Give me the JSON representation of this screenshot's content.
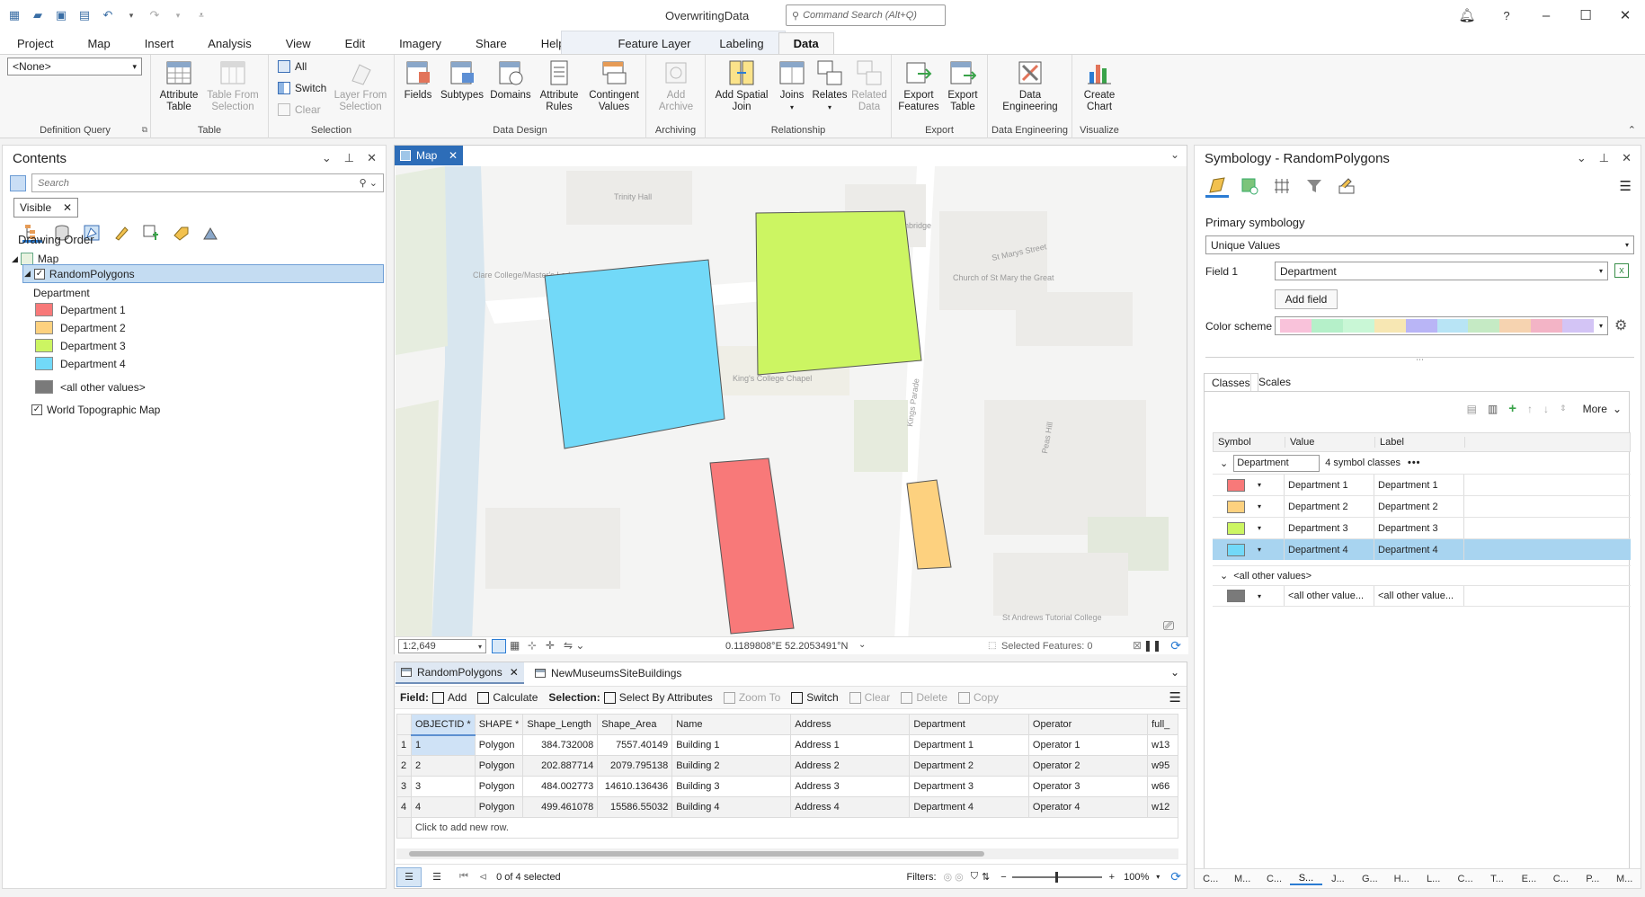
{
  "app": {
    "window_title": "OverwritingData",
    "command_search_placeholder": "Command Search (Alt+Q)"
  },
  "ribbon_tabs": [
    "Project",
    "Map",
    "Insert",
    "Analysis",
    "View",
    "Edit",
    "Imagery",
    "Share",
    "Help",
    "Feature Layer",
    "Labeling",
    "Data"
  ],
  "ribbon": {
    "definition_query_value": "<None>",
    "groups": {
      "definition_query": "Definition Query",
      "table": "Table",
      "selection": "Selection",
      "data_design": "Data Design",
      "archiving": "Archiving",
      "relationship": "Relationship",
      "export": "Export",
      "data_engineering": "Data Engineering",
      "visualize": "Visualize"
    },
    "buttons": {
      "attribute_table": "Attribute Table",
      "table_from_selection": "Table From Selection",
      "all": "All",
      "switch": "Switch",
      "clear": "Clear",
      "layer_from_selection": "Layer From Selection",
      "fields": "Fields",
      "subtypes": "Subtypes",
      "domains": "Domains",
      "attribute_rules": "Attribute Rules",
      "contingent_values": "Contingent Values",
      "add_archive": "Add Archive",
      "add_spatial_join": "Add Spatial Join",
      "joins": "Joins",
      "relates": "Relates",
      "related_data": "Related Data",
      "export_features": "Export Features",
      "export_table": "Export Table",
      "data_engineering": "Data Engineering",
      "create_chart": "Create Chart"
    }
  },
  "contents": {
    "title": "Contents",
    "search_placeholder": "Search",
    "filter_chip": "Visible",
    "drawing_order": "Drawing Order",
    "map_node": "Map",
    "layer": "RandomPolygons",
    "field_heading": "Department",
    "classes": [
      {
        "label": "Department 1",
        "color": "#f87979"
      },
      {
        "label": "Department 2",
        "color": "#fdd17f"
      },
      {
        "label": "Department 3",
        "color": "#ccf562"
      },
      {
        "label": "Department 4",
        "color": "#72d9f8"
      }
    ],
    "other_values": {
      "label": "<all other values>",
      "color": "#7a7a7a"
    },
    "basemap": "World Topographic Map"
  },
  "map": {
    "tab_label": "Map",
    "scale": "1:2,649",
    "coordinates": "0.1189808°E 52.2053491°N",
    "selected_features": "Selected Features: 0",
    "basemap_labels": [
      "Trinity Hall",
      "University of Cambridge",
      "St Marys Street",
      "Clare College/Master's Lodge",
      "Church of St Mary the Great",
      "King's College Chapel",
      "Kings Parade",
      "Peas Hill",
      "St Andrews Tutorial College"
    ]
  },
  "table": {
    "tabs": [
      "RandomPolygons",
      "NewMuseumsSiteBuildings"
    ],
    "toolbar": {
      "field_label": "Field:",
      "add": "Add",
      "calculate": "Calculate",
      "selection_label": "Selection:",
      "select_by_attributes": "Select By Attributes",
      "zoom_to": "Zoom To",
      "switch": "Switch",
      "clear": "Clear",
      "delete": "Delete",
      "copy": "Copy"
    },
    "columns": [
      "OBJECTID *",
      "SHAPE *",
      "Shape_Length",
      "Shape_Area",
      "Name",
      "Address",
      "Department",
      "Operator",
      "full_"
    ],
    "rows": [
      [
        "1",
        "Polygon",
        "384.732008",
        "7557.40149",
        "Building 1",
        "Address 1",
        "Department 1",
        "Operator 1",
        "w13"
      ],
      [
        "2",
        "Polygon",
        "202.887714",
        "2079.795138",
        "Building 2",
        "Address 2",
        "Department 2",
        "Operator 2",
        "w95"
      ],
      [
        "3",
        "Polygon",
        "484.002773",
        "14610.136436",
        "Building 3",
        "Address 3",
        "Department 3",
        "Operator 3",
        "w66"
      ],
      [
        "4",
        "Polygon",
        "499.461078",
        "15586.55032",
        "Building 4",
        "Address 4",
        "Department 4",
        "Operator 4",
        "w12"
      ]
    ],
    "add_row_hint": "Click to add new row.",
    "selected_count": "0 of 4 selected",
    "filters_label": "Filters:",
    "zoom": "100%"
  },
  "symbology": {
    "title": "Symbology - RandomPolygons",
    "primary_label": "Primary symbology",
    "method": "Unique Values",
    "field1_label": "Field 1",
    "field1_value": "Department",
    "add_field": "Add field",
    "color_scheme_label": "Color scheme",
    "color_scheme_colors": [
      "#f9c2da",
      "#b5f0c9",
      "#c9f7d6",
      "#f7e7b3",
      "#b9b5f6",
      "#b8e4f5",
      "#c5eac4",
      "#f6d3b0",
      "#f3b4c6",
      "#d3c4f5"
    ],
    "subtabs": [
      "Classes",
      "Scales"
    ],
    "more": "More",
    "headers": [
      "Symbol",
      "Value",
      "Label"
    ],
    "heading_field": "Department",
    "symbol_classes_count": "4 symbol classes",
    "classes": [
      {
        "value": "Department 1",
        "label": "Department 1",
        "color": "#f87979"
      },
      {
        "value": "Department 2",
        "label": "Department 2",
        "color": "#fdd17f"
      },
      {
        "value": "Department 3",
        "label": "Department 3",
        "color": "#ccf562"
      },
      {
        "value": "Department 4",
        "label": "Department 4",
        "color": "#72d9f8"
      }
    ],
    "other_heading": "<all other values>",
    "other_row": {
      "value": "<all other value...",
      "label": "<all other value...",
      "color": "#7a7a7a"
    },
    "bottom_tabs": [
      "C...",
      "M...",
      "C...",
      "S...",
      "J...",
      "G...",
      "H...",
      "L...",
      "C...",
      "T...",
      "E...",
      "C...",
      "P...",
      "M..."
    ]
  }
}
